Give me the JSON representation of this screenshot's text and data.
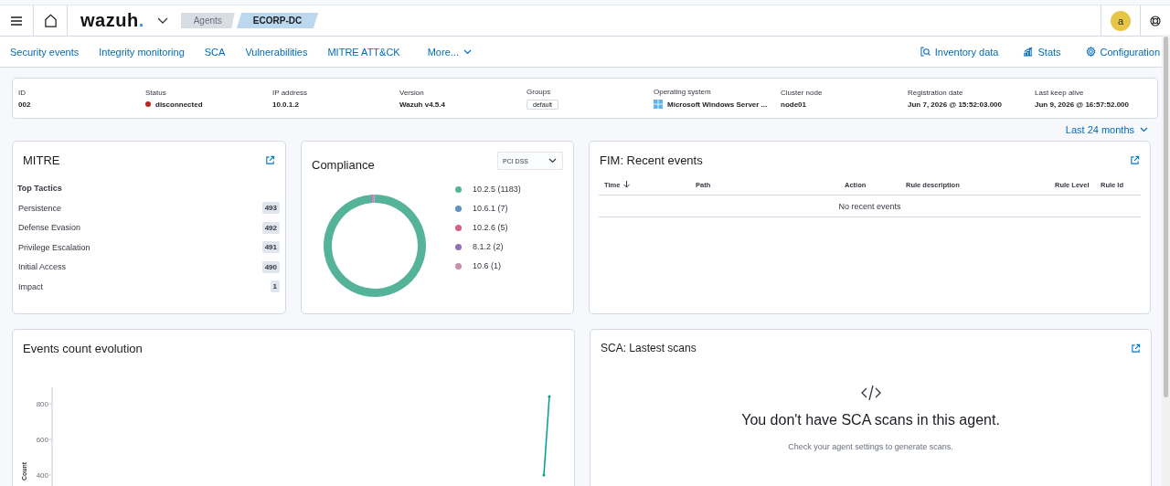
{
  "header": {
    "logo": "wazuh.",
    "breadcrumbs": [
      {
        "label": "Agents",
        "selected": false
      },
      {
        "label": "ECORP-DC",
        "selected": true
      }
    ],
    "avatar": "a"
  },
  "nav": {
    "tabs": [
      "Security events",
      "Integrity monitoring",
      "SCA",
      "Vulnerabilities",
      "MITRE ATT&CK"
    ],
    "more": "More...",
    "actions": [
      {
        "label": "Inventory data",
        "kind": "inventory"
      },
      {
        "label": "Stats",
        "kind": "stats"
      },
      {
        "label": "Configuration",
        "kind": "config"
      }
    ]
  },
  "agent": {
    "fields": [
      {
        "label": "ID",
        "value": "002",
        "kind": "text"
      },
      {
        "label": "Status",
        "value": "disconnected",
        "kind": "status",
        "color": "#bd271e"
      },
      {
        "label": "IP address",
        "value": "10.0.1.2",
        "kind": "text"
      },
      {
        "label": "Version",
        "value": "Wazuh v4.5.4",
        "kind": "text"
      },
      {
        "label": "Groups",
        "value": "default",
        "kind": "badge"
      },
      {
        "label": "Operating system",
        "value": "Microsoft Windows Server ...",
        "kind": "os"
      },
      {
        "label": "Cluster node",
        "value": "node01",
        "kind": "text"
      },
      {
        "label": "Registration date",
        "value": "Jun 7, 2026 @ 15:52:03.000",
        "kind": "text"
      },
      {
        "label": "Last keep alive",
        "value": "Jun 9, 2026 @ 16:57:52.000",
        "kind": "text"
      }
    ]
  },
  "date_picker": "Last 24 months",
  "mitre": {
    "title": "MITRE",
    "subtitle": "Top Tactics",
    "tactics": [
      {
        "name": "Persistence",
        "count": "493"
      },
      {
        "name": "Defense Evasion",
        "count": "492"
      },
      {
        "name": "Privilege Escalation",
        "count": "491"
      },
      {
        "name": "Initial Access",
        "count": "490"
      },
      {
        "name": "Impact",
        "count": "1"
      }
    ]
  },
  "compliance": {
    "title": "Compliance",
    "standard": "PCI DSS",
    "legend": [
      {
        "label": "10.2.5 (1183)",
        "color": "#54b399"
      },
      {
        "label": "10.6.1 (7)",
        "color": "#6092c0"
      },
      {
        "label": "10.2.6 (5)",
        "color": "#d36086"
      },
      {
        "label": "8.1.2 (2)",
        "color": "#9170b8"
      },
      {
        "label": "10.6 (1)",
        "color": "#ca8eae"
      }
    ]
  },
  "fim": {
    "title": "FIM: Recent events",
    "columns": [
      {
        "label": "Time",
        "sorted": true
      },
      {
        "label": "Path",
        "sorted": false
      },
      {
        "label": "Action",
        "sorted": false
      },
      {
        "label": "Rule description",
        "sorted": false
      },
      {
        "label": "Rule Level",
        "sorted": false
      },
      {
        "label": "Rule Id",
        "sorted": false
      }
    ],
    "empty": "No recent events"
  },
  "events": {
    "title": "Events count evolution",
    "y_axis": {
      "label": "Count",
      "ticks": [
        "800",
        "600",
        "400"
      ]
    }
  },
  "sca": {
    "title": "SCA: Lastest scans",
    "message": "You don't have SCA scans in this agent.",
    "hint": "Check your agent settings to generate scans."
  }
}
